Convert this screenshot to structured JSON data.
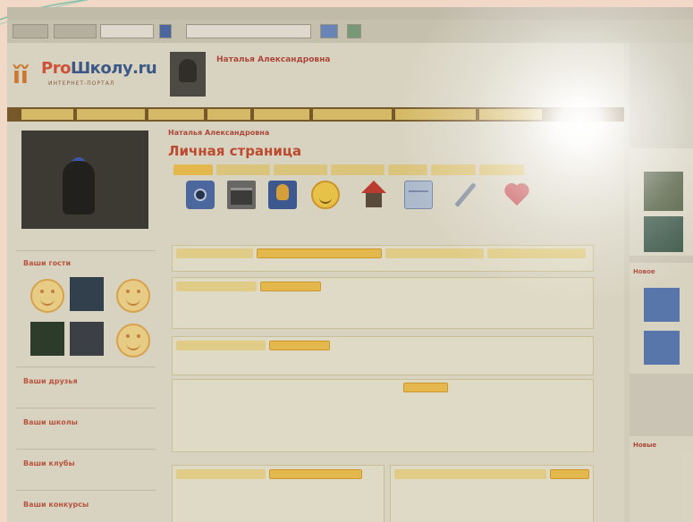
{
  "browser": {
    "titlebar": "",
    "back_label": "",
    "nav_label": "",
    "address": ""
  },
  "site": {
    "logo_text_pro": "Pro",
    "logo_text_rest": "Школу.ru",
    "logo_subtitle": "ИНТЕРНЕТ-ПОРТАЛ",
    "header_user": {
      "name": "Наталья Александровна"
    }
  },
  "navbar": {
    "items": [
      "",
      "",
      "",
      "",
      "",
      "",
      "",
      ""
    ]
  },
  "left": {
    "photo_caption": "",
    "guests_title": "Ваши гости",
    "friends_title": "Ваши друзья",
    "schools_title": "Ваши школы",
    "clubs_title": "Ваши клубы",
    "contests_title": "Ваши конкурсы"
  },
  "main": {
    "user_fullname": "Наталья Александровна",
    "page_title": "Личная страница",
    "tabs": [
      "",
      "",
      "",
      "",
      "",
      "",
      ""
    ],
    "icons": [
      {
        "icon": "camera-icon"
      },
      {
        "icon": "books-icon"
      },
      {
        "icon": "bulb-icon"
      },
      {
        "icon": "smiley-icon"
      },
      {
        "icon": "house-icon"
      },
      {
        "icon": "mail-icon"
      },
      {
        "icon": "wrench-icon"
      },
      {
        "icon": "heart-icon"
      }
    ]
  },
  "right": {
    "block1_title": "",
    "block2_title": "Новое",
    "block3_title": "Новые"
  },
  "colors": {
    "accent": "#c44a2e",
    "link": "#5a6fa0",
    "nav_bg": "#7a5a2a",
    "pill": "#ecd78c"
  }
}
